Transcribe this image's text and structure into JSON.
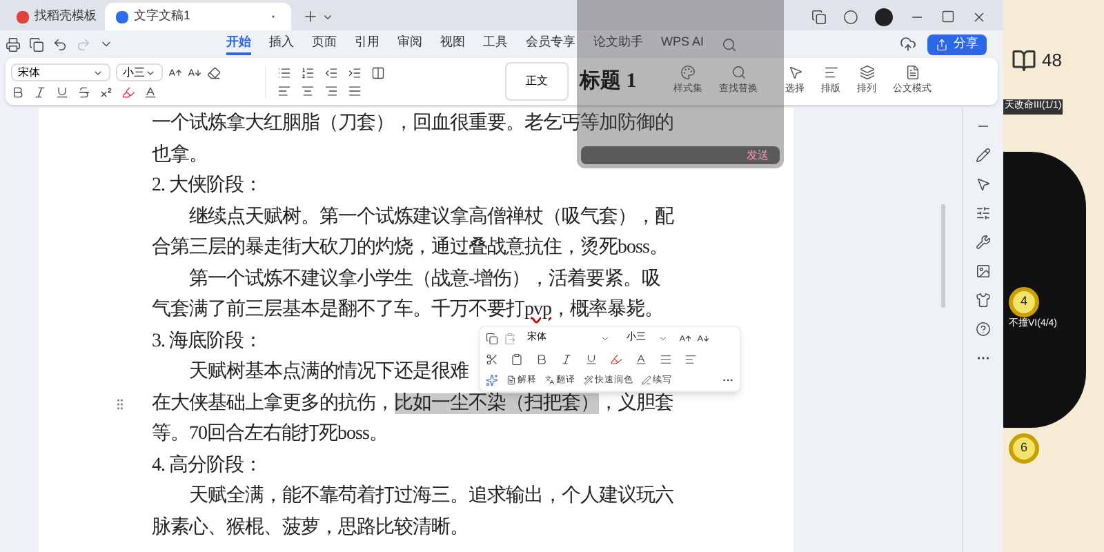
{
  "tabs": [
    {
      "label": "找稻壳模板",
      "selected": false,
      "kind": "template"
    },
    {
      "label": "文字文稿1",
      "selected": true,
      "kind": "doc"
    }
  ],
  "menu": [
    {
      "label": "开始",
      "selected": true
    },
    {
      "label": "插入",
      "selected": false
    },
    {
      "label": "页面",
      "selected": false
    },
    {
      "label": "引用",
      "selected": false
    },
    {
      "label": "审阅",
      "selected": false
    },
    {
      "label": "视图",
      "selected": false
    },
    {
      "label": "工具",
      "selected": false
    },
    {
      "label": "会员专享",
      "selected": false
    },
    {
      "label": "论文助手",
      "selected": false
    },
    {
      "label": "WPS AI",
      "selected": false
    }
  ],
  "share_button": "分享",
  "ribbon": {
    "font": "宋体",
    "size": "小三",
    "styles": [
      {
        "label": "正文",
        "kind": "body"
      },
      {
        "label": "标题 1",
        "kind": "heading"
      }
    ],
    "tools": [
      {
        "label": "样式集",
        "kind": "styles"
      },
      {
        "label": "查找替换",
        "kind": "find"
      },
      {
        "label": "选择",
        "kind": "select"
      },
      {
        "label": "排版",
        "kind": "layout"
      },
      {
        "label": "排列",
        "kind": "arrange"
      },
      {
        "label": "公文模式",
        "kind": "official"
      }
    ]
  },
  "overlay": {
    "send_button": "发送"
  },
  "document": {
    "lines": [
      {
        "indent": false,
        "segments": [
          {
            "text": "一个试炼拿大红胭脂（刀套），回血很重要。老乞丐等加防御的",
            "kind": "text"
          }
        ]
      },
      {
        "indent": false,
        "segments": [
          {
            "text": "也拿。",
            "kind": "text"
          }
        ]
      },
      {
        "indent": false,
        "segments": [
          {
            "text": "2. 大侠阶段：",
            "kind": "text"
          }
        ]
      },
      {
        "indent": true,
        "segments": [
          {
            "text": "继续点天赋树。第一个试炼建议拿高僧禅杖（吸气套），配",
            "kind": "text"
          }
        ]
      },
      {
        "indent": false,
        "segments": [
          {
            "text": "合第三层的暴走街大砍刀的灼烧，通过叠战意抗住，烫死boss。",
            "kind": "text"
          }
        ]
      },
      {
        "indent": true,
        "segments": [
          {
            "text": "第一个试炼不建议拿小学生（战意-增伤），活着要紧。吸",
            "kind": "text"
          }
        ]
      },
      {
        "indent": false,
        "segments": [
          {
            "text": "气套满了前三层基本是翻不了车。千万不要打",
            "kind": "text"
          },
          {
            "text": "pvp",
            "kind": "spellcheck"
          },
          {
            "text": "，概率暴毙。",
            "kind": "text"
          }
        ]
      },
      {
        "indent": false,
        "segments": [
          {
            "text": "3. 海底阶段：",
            "kind": "text"
          }
        ]
      },
      {
        "indent": true,
        "segments": [
          {
            "text": "天赋树基本点满的情况下还是很难",
            "kind": "text"
          }
        ]
      },
      {
        "indent": false,
        "segments": [
          {
            "text": "在大侠基础上拿更多的抗伤，",
            "kind": "text"
          },
          {
            "text": "比如一尘不染（扫把套）",
            "kind": "selection"
          },
          {
            "text": "，义胆套",
            "kind": "text"
          }
        ]
      },
      {
        "indent": false,
        "segments": [
          {
            "text": "等。70回合左右能打死boss。",
            "kind": "text"
          }
        ]
      },
      {
        "indent": false,
        "segments": [
          {
            "text": "4. 高分阶段：",
            "kind": "text"
          }
        ]
      },
      {
        "indent": true,
        "segments": [
          {
            "text": "天赋全满，能不靠苟着打过海三。追求输出，个人建议玩六",
            "kind": "text"
          }
        ]
      },
      {
        "indent": false,
        "segments": [
          {
            "text": "脉素心、猴棍、菠萝，思路比较清晰。",
            "kind": "text"
          }
        ]
      }
    ]
  },
  "popup": {
    "font": "宋体",
    "size": "小三",
    "actions": [
      "解释",
      "翻译",
      "快速润色",
      "续写"
    ]
  },
  "game": {
    "count": "48",
    "banner": "天改命III(1/1)",
    "nodes": [
      {
        "number": "4",
        "label": "不撞VI(4/4)"
      },
      {
        "number": "6"
      }
    ]
  }
}
